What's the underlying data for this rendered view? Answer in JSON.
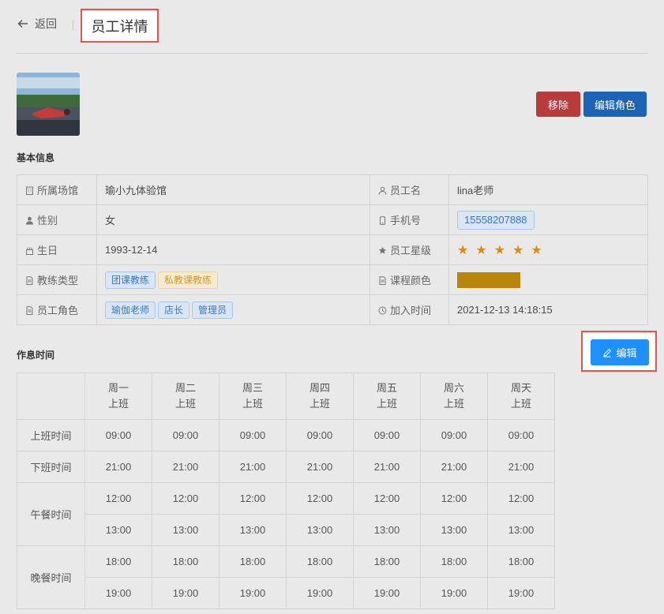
{
  "header": {
    "back_label": "返回",
    "title": "员工详情"
  },
  "actions": {
    "remove_label": "移除",
    "edit_role_label": "编辑角色",
    "edit_label": "编辑"
  },
  "basic_info": {
    "section_title": "基本信息",
    "venue_label": "所属场馆",
    "venue_value": "瑜小九体验馆",
    "name_label": "员工名",
    "name_value": "lina老师",
    "gender_label": "性别",
    "gender_value": "女",
    "phone_label": "手机号",
    "phone_value": "15558207888",
    "birthday_label": "生日",
    "birthday_value": "1993-12-14",
    "star_label": "员工星级",
    "star_rating": 5,
    "coach_type_label": "教练类型",
    "coach_types": [
      "团课教练",
      "私教课教练"
    ],
    "course_color_label": "课程颜色",
    "course_color": "#b8860b",
    "role_label": "员工角色",
    "roles": [
      "瑜伽老师",
      "店长",
      "管理员"
    ],
    "join_label": "加入时间",
    "join_value": "2021-12-13 14:18:15"
  },
  "schedule": {
    "section_title": "作息时间",
    "days": [
      {
        "day": "周一",
        "status": "上班"
      },
      {
        "day": "周二",
        "status": "上班"
      },
      {
        "day": "周三",
        "status": "上班"
      },
      {
        "day": "周四",
        "status": "上班"
      },
      {
        "day": "周五",
        "status": "上班"
      },
      {
        "day": "周六",
        "status": "上班"
      },
      {
        "day": "周天",
        "status": "上班"
      }
    ],
    "rows": {
      "work_start": {
        "label": "上班时间",
        "values": [
          "09:00",
          "09:00",
          "09:00",
          "09:00",
          "09:00",
          "09:00",
          "09:00"
        ]
      },
      "work_end": {
        "label": "下班时间",
        "values": [
          "21:00",
          "21:00",
          "21:00",
          "21:00",
          "21:00",
          "21:00",
          "21:00"
        ]
      },
      "lunch": {
        "label": "午餐时间",
        "start": [
          "12:00",
          "12:00",
          "12:00",
          "12:00",
          "12:00",
          "12:00",
          "12:00"
        ],
        "end": [
          "13:00",
          "13:00",
          "13:00",
          "13:00",
          "13:00",
          "13:00",
          "13:00"
        ]
      },
      "dinner": {
        "label": "晚餐时间",
        "start": [
          "18:00",
          "18:00",
          "18:00",
          "18:00",
          "18:00",
          "18:00",
          "18:00"
        ],
        "end": [
          "19:00",
          "19:00",
          "19:00",
          "19:00",
          "19:00",
          "19:00",
          "19:00"
        ]
      }
    }
  }
}
